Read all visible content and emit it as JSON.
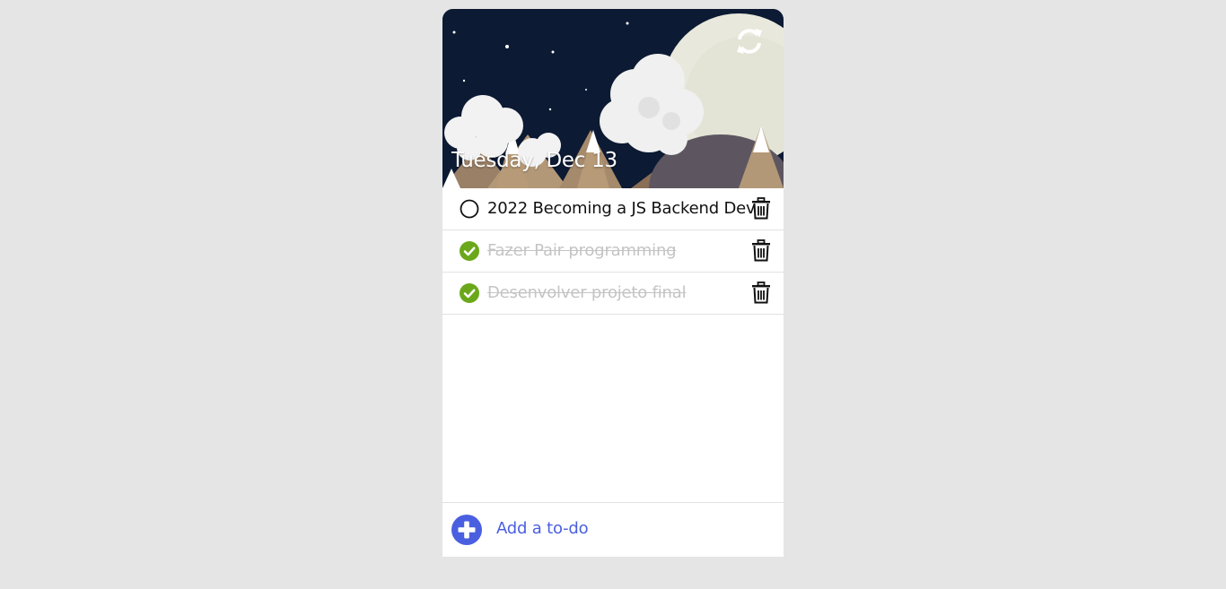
{
  "header": {
    "date": "Tuesday, Dec 13",
    "refresh_icon": "refresh-icon"
  },
  "todos": [
    {
      "text": "2022 Becoming a JS Backend Dev",
      "done": false
    },
    {
      "text": "Fazer Pair programming",
      "done": true
    },
    {
      "text": "Desenvolver projeto final",
      "done": true
    }
  ],
  "footer": {
    "add_label": "Add a to-do",
    "add_icon": "plus-circle-icon"
  },
  "colors": {
    "background": "#e5e5e5",
    "card": "#ffffff",
    "accent": "#4a5fe0",
    "done_check": "#6aa81a",
    "done_text": "#c4c4c4",
    "header_sky": "#0c1a33"
  }
}
